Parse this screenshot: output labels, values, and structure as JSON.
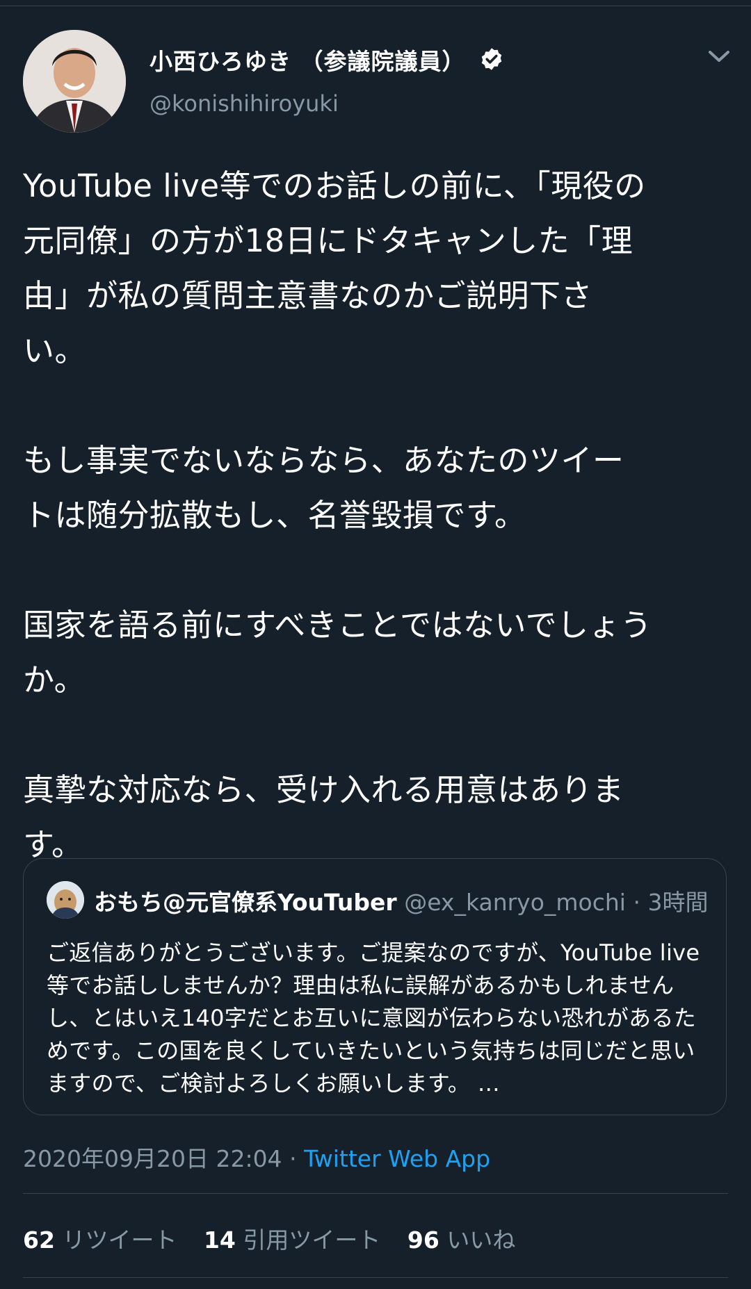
{
  "tweet": {
    "display_name": "小西ひろゆき （参議院議員）",
    "handle": "@konishihiroyuki",
    "icons": {
      "verified": "verified-badge-icon",
      "menu": "chevron-down-icon"
    },
    "body": "YouTube live等でのお話しの前に、「現役の\n元同僚」の方が18日にドタキャンした「理\n由」が私の質問主意書なのかご説明下さ\nい。\n\nもし事実でないならなら、あなたのツイー\nトは随分拡散もし、名誉毀損です。\n\n国家を語る前にすべきことではないでしょう\nか。\n\n真摯な対応なら、受け入れる用意はありま\nす。"
  },
  "quoted": {
    "display_name": "おもち@元官僚系YouTuber",
    "handle": "@ex_kanryo_mochi",
    "time": "· 3時間",
    "text": "ご返信ありがとうございます。ご提案なのですが、YouTube live等でお話ししませんか？理由は私に誤解があるかもしれませんし、とはいえ140字だとお互いに意図が伝わらない恐れがあるためです。この国を良くしていきたいという気持ちは同じだと思いますので、ご検討よろしくお願いします。 …"
  },
  "meta": {
    "timestamp": "2020年09月20日 22:04",
    "separator": "·",
    "source": "Twitter Web App"
  },
  "stats": {
    "retweets": {
      "count": "62",
      "label": "リツイート"
    },
    "quotes": {
      "count": "14",
      "label": "引用ツイート"
    },
    "likes": {
      "count": "96",
      "label": "いいね"
    }
  },
  "colors": {
    "background": "#15202b",
    "muted": "#8899a6",
    "link": "#1da1f2",
    "border": "#38444d"
  }
}
